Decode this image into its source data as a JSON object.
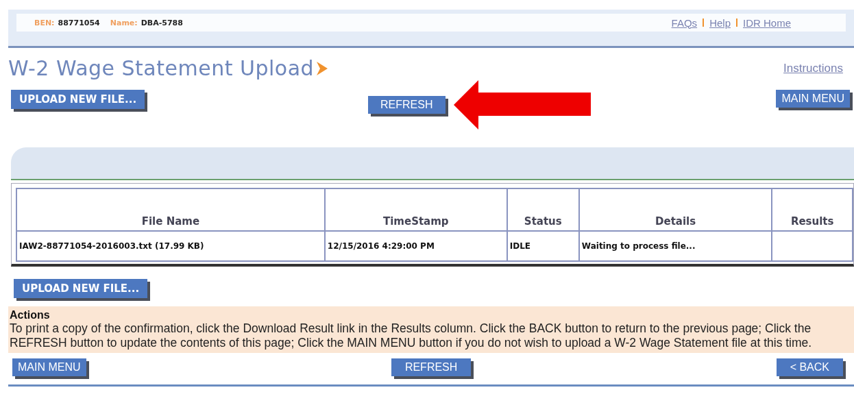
{
  "header": {
    "ben_label": "BEN:",
    "ben": "88771054",
    "name_label": "Name:",
    "name": "DBA-5788",
    "links": [
      "FAQs",
      "Help",
      "IDR Home"
    ]
  },
  "title": "W-2 Wage Statement Upload",
  "instructions_link": "Instructions",
  "top_buttons": {
    "upload": "UPLOAD NEW FILE...",
    "refresh": "REFRESH",
    "main_menu": "MAIN MENU"
  },
  "table": {
    "columns": [
      "File Name",
      "TimeStamp",
      "Status",
      "Details",
      "Results"
    ],
    "rows": [
      [
        "IAW2-88771054-2016003.txt (17.99 KB)",
        "12/15/2016 4:29:00 PM",
        "IDLE",
        "Waiting to process file...",
        ""
      ]
    ]
  },
  "upload_button": "UPLOAD NEW FILE...",
  "actions": {
    "title": "Actions",
    "text": "To print a copy of the confirmation, click the Download Result link in the Results column. Click the BACK button to return to the previous page; Click the REFRESH button to update the contents of this page; Click the MAIN MENU button if you do not wish to upload a W-2 Wage Statement file at this time."
  },
  "bottom_buttons": {
    "main_menu": "MAIN MENU",
    "refresh": "REFRESH",
    "back": "< BACK"
  }
}
